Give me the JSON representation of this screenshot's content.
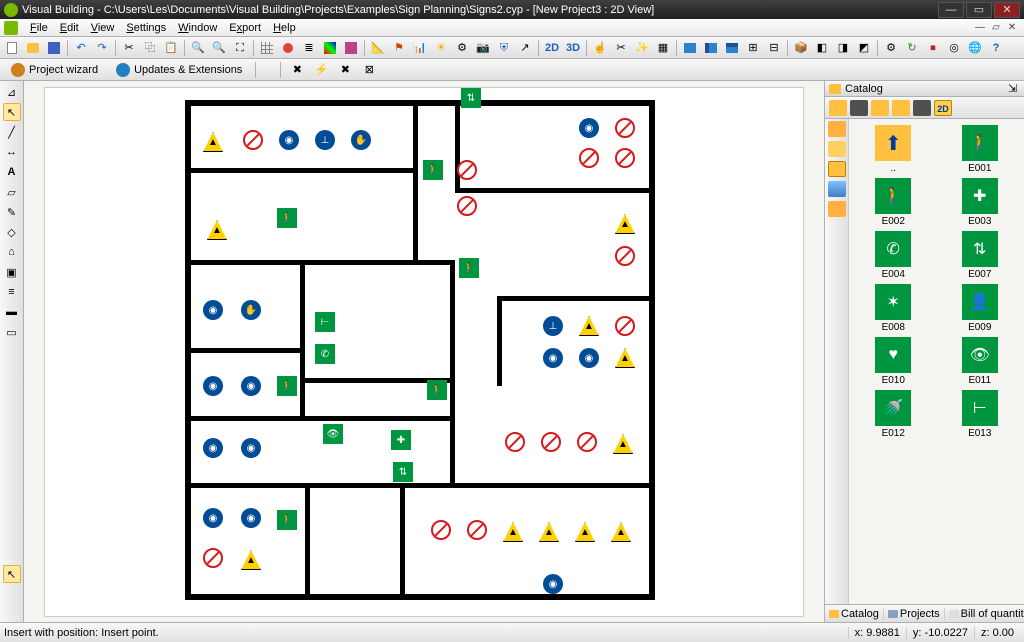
{
  "title": "Visual Building - C:\\Users\\Les\\Documents\\Visual Building\\Projects\\Examples\\Sign Planning\\Signs2.cyp - [New Project3 : 2D View]",
  "menu": {
    "file": "File",
    "edit": "Edit",
    "view": "View",
    "settings": "Settings",
    "window": "Window",
    "export": "Export",
    "help": "Help"
  },
  "secondbar": {
    "wizard": "Project wizard",
    "updates": "Updates & Extensions"
  },
  "catalog": {
    "title": "Catalog",
    "up_label": "..",
    "items": [
      "E001",
      "E002",
      "E003",
      "E004",
      "E007",
      "E008",
      "E009",
      "E010",
      "E011",
      "E012",
      "E013"
    ],
    "tabs": [
      "Catalog",
      "Projects",
      "Bill of quantiti..."
    ],
    "tb2d": "2D"
  },
  "status": {
    "left": "Insert with position: Insert point.",
    "x": "x: 9.9881",
    "y": "y: -10.0227",
    "z": "z: 0.00"
  }
}
